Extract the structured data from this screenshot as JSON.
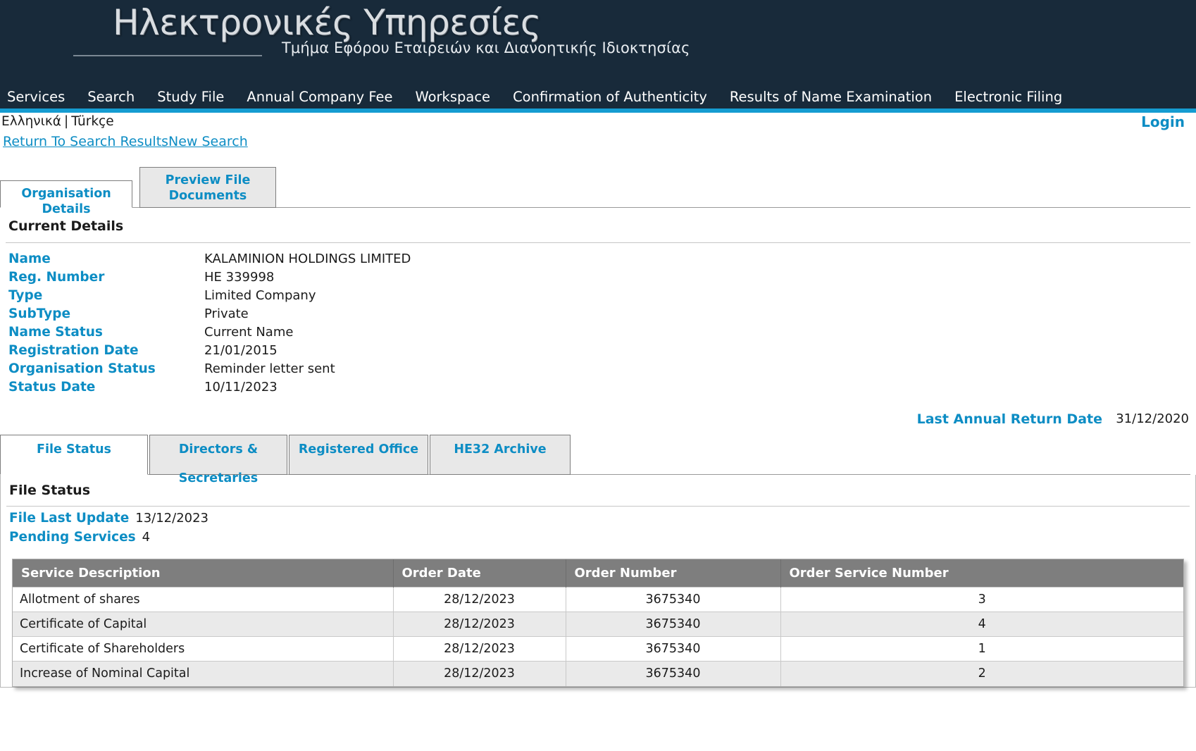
{
  "masthead": {
    "title": "Ηλεκτρονικές Υπηρεσίες",
    "subtitle": "Τμήμα Εφόρου Εταιρειών και Διανοητικής Ιδιοκτησίας"
  },
  "colors": {
    "header_bg": "#182a3a",
    "accent_bar": "#159cd1",
    "link_blue": "#0d8dc4",
    "table_header_bg": "#7e7e7e",
    "tab_inactive_bg": "#e8e8e8",
    "row_alt_bg": "#eaeaea"
  },
  "mainnav": {
    "items": [
      {
        "label": "Services"
      },
      {
        "label": "Search"
      },
      {
        "label": "Study File"
      },
      {
        "label": "Annual Company Fee"
      },
      {
        "label": "Workspace"
      },
      {
        "label": "Confirmation of Authenticity"
      },
      {
        "label": "Results of Name Examination"
      },
      {
        "label": "Electronic Filing"
      }
    ]
  },
  "langbar": {
    "greek": "Ελληνικά",
    "separator": "|",
    "turkish": "Türkçe",
    "login": "Login"
  },
  "searchlinks": {
    "return_to_search_results": "Return To Search Results",
    "new_search": "New Search"
  },
  "outer_tabs": [
    {
      "label": "Organisation Details",
      "active": true
    },
    {
      "label": "Preview File Documents",
      "active": false
    }
  ],
  "current_details": {
    "heading": "Current Details",
    "rows": [
      {
        "label": "Name",
        "value": "KALAMINION HOLDINGS LIMITED"
      },
      {
        "label": "Reg. Number",
        "value": "HE 339998"
      },
      {
        "label": "Type",
        "value": "Limited Company"
      },
      {
        "label": "SubType",
        "value": "Private"
      },
      {
        "label": "Name Status",
        "value": "Current Name"
      },
      {
        "label": "Registration Date",
        "value": "21/01/2015"
      },
      {
        "label": "Organisation Status",
        "value": "Reminder letter sent"
      },
      {
        "label": "Status Date",
        "value": "10/11/2023"
      }
    ],
    "last_annual_return_label": "Last Annual Return Date",
    "last_annual_return_value": "31/12/2020"
  },
  "inner_tabs": [
    {
      "label": "File Status",
      "active": true
    },
    {
      "label": "Directors & Secretaries",
      "active": false
    },
    {
      "label": "Registered Office",
      "active": false
    },
    {
      "label": "HE32 Archive",
      "active": false
    }
  ],
  "file_status": {
    "heading": "File Status",
    "file_last_update_label": "File Last Update",
    "file_last_update_value": "13/12/2023",
    "pending_services_label": "Pending Services",
    "pending_services_value": "4"
  },
  "services_table": {
    "columns": [
      "Service Description",
      "Order Date",
      "Order Number",
      "Order Service Number"
    ],
    "rows": [
      {
        "description": "Allotment of shares",
        "order_date": "28/12/2023",
        "order_number": "3675340",
        "order_service_number": "3"
      },
      {
        "description": "Certificate of Capital",
        "order_date": "28/12/2023",
        "order_number": "3675340",
        "order_service_number": "4"
      },
      {
        "description": "Certificate of Shareholders",
        "order_date": "28/12/2023",
        "order_number": "3675340",
        "order_service_number": "1"
      },
      {
        "description": "Increase of Nominal Capital",
        "order_date": "28/12/2023",
        "order_number": "3675340",
        "order_service_number": "2"
      }
    ]
  }
}
